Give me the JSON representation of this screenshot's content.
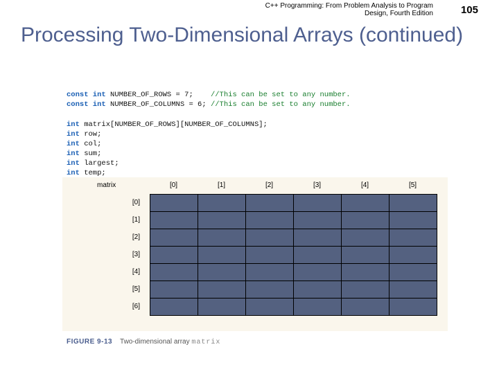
{
  "header": {
    "book_title": "C++ Programming: From Problem Analysis to Program\nDesign, Fourth Edition",
    "page_number": "105"
  },
  "title": "Processing Two-Dimensional Arrays (continued)",
  "code": {
    "line1_a": "const int",
    "line1_b": " NUMBER_OF_ROWS = 7;    ",
    "line1_c": "//This can be set to any number.",
    "line2_a": "const int",
    "line2_b": " NUMBER_OF_COLUMNS = 6; ",
    "line2_c": "//This can be set to any number.",
    "line3_a": "int",
    "line3_b": " matrix[NUMBER_OF_ROWS][NUMBER_OF_COLUMNS];",
    "line4_a": "int",
    "line4_b": " row;",
    "line5_a": "int",
    "line5_b": " col;",
    "line6_a": "int",
    "line6_b": " sum;",
    "line7_a": "int",
    "line7_b": " largest;",
    "line8_a": "int",
    "line8_b": " temp;"
  },
  "matrix": {
    "label": "matrix",
    "col_headers": [
      "[0]",
      "[1]",
      "[2]",
      "[3]",
      "[4]",
      "[5]"
    ],
    "row_labels": [
      "[0]",
      "[1]",
      "[2]",
      "[3]",
      "[4]",
      "[5]",
      "[6]"
    ]
  },
  "figure": {
    "label": "FIGURE 9-13",
    "caption_text": "Two-dimensional array ",
    "mono_text": "matrix"
  }
}
